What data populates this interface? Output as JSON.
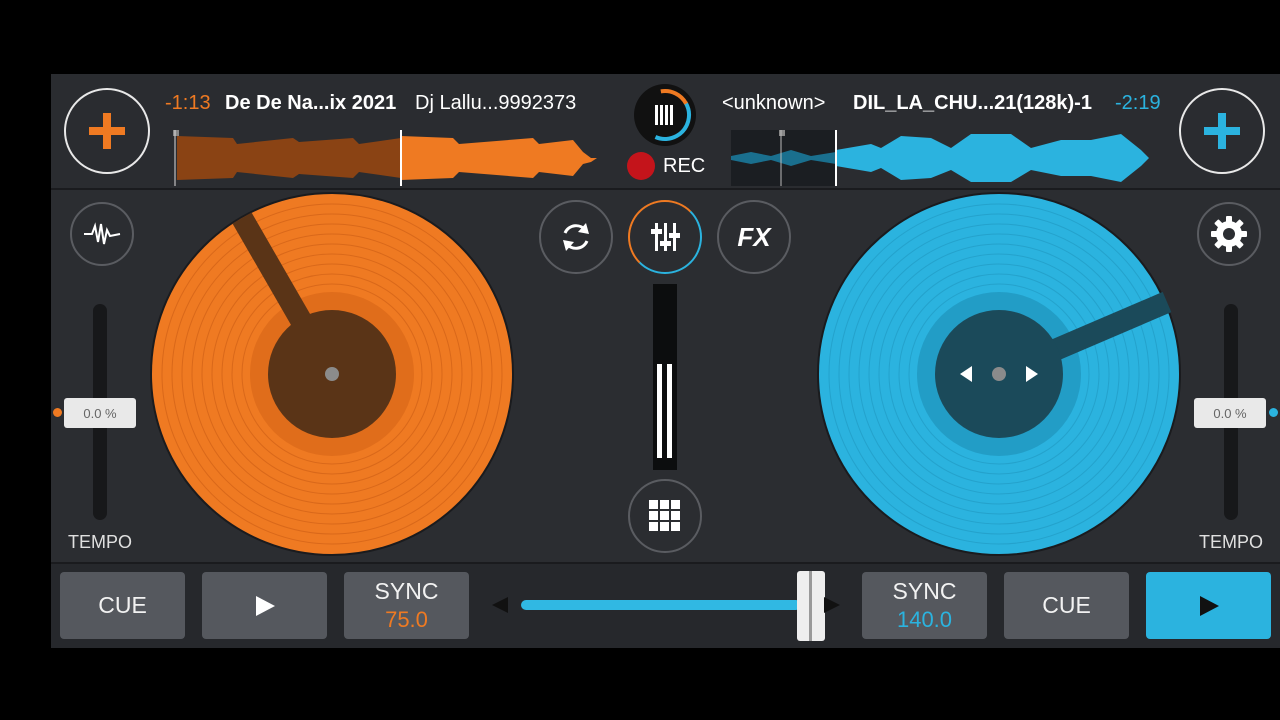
{
  "deck_left": {
    "remaining_time": "-1:13",
    "title": "De De Na...ix 2021",
    "artist": "Dj Lallu...9992373",
    "bpm": "75.0",
    "tempo": "0.0 %",
    "tempo_label": "TEMPO",
    "cue_label": "CUE",
    "sync_label": "SYNC",
    "accent": "#ef7a22"
  },
  "deck_right": {
    "remaining_time": "-2:19",
    "title": "DIL_LA_CHU...21(128k)-1",
    "artist": "<unknown>",
    "bpm": "140.0",
    "tempo": "0.0 %",
    "tempo_label": "TEMPO",
    "cue_label": "CUE",
    "sync_label": "SYNC",
    "accent": "#2bb3df"
  },
  "center": {
    "rec_label": "REC",
    "fx_label": "FX"
  },
  "crossfader": {
    "position": 0.92
  },
  "icons": [
    "plus-icon",
    "waveform-icon",
    "sync-loop-icon",
    "mixer-icon",
    "fx-icon",
    "settings-gear-icon",
    "pads-grid-icon",
    "play-icon",
    "record-icon",
    "app-logo-icon"
  ]
}
